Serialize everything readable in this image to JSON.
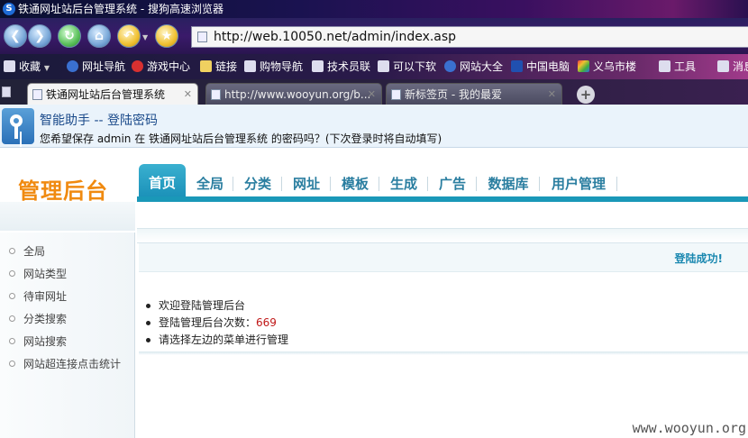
{
  "window": {
    "title": "铁通网址站后台管理系统 - 搜狗高速浏览器"
  },
  "address_bar": {
    "url": "http://web.10050.net/admin/index.asp"
  },
  "favorites": [
    {
      "label": "收藏",
      "icon": "favorites-icon"
    },
    {
      "label": "网址导航",
      "icon": "sogou-icon"
    },
    {
      "label": "游戏中心",
      "icon": "game-icon"
    },
    {
      "label": "链接",
      "icon": "folder-icon"
    },
    {
      "label": "购物导航",
      "icon": "page-icon"
    },
    {
      "label": "技术员联",
      "icon": "page-icon"
    },
    {
      "label": "可以下软",
      "icon": "page-icon"
    },
    {
      "label": "网站大全",
      "icon": "sogou-icon"
    },
    {
      "label": "中国电脑",
      "icon": "page-icon"
    },
    {
      "label": "义乌市楼",
      "icon": "page-icon"
    },
    {
      "label": "工具",
      "icon": "tools-icon"
    },
    {
      "label": "消息",
      "icon": "message-icon"
    }
  ],
  "tabs": [
    {
      "label": "铁通网址站后台管理系统",
      "active": true
    },
    {
      "label": "http://www.wooyun.org/b...",
      "active": false
    },
    {
      "label": "新标签页 - 我的最爱",
      "active": false
    }
  ],
  "password_prompt": {
    "title": "智能助手 -- 登陆密码",
    "text": "您希望保存 admin 在 铁通网址站后台管理系统 的密码吗？(下次登录时将自动填写)"
  },
  "admin": {
    "brand": "管理后台",
    "nav": [
      "首页",
      "全局",
      "分类",
      "网址",
      "模板",
      "生成",
      "广告",
      "数据库",
      "用户管理"
    ],
    "sidebar": [
      "全局",
      "网站类型",
      "待审网址",
      "分类搜索",
      "网站搜索",
      "网站超连接点击统计"
    ],
    "status": "登陆成功!",
    "messages": {
      "welcome": "欢迎登陆管理后台",
      "count_label": "登陆管理后台次数：",
      "count": "669",
      "instruction": "请选择左边的菜单进行管理"
    }
  },
  "watermark": "www.wooyun.org"
}
